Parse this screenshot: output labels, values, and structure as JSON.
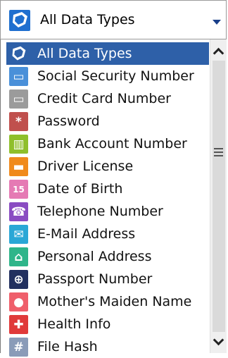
{
  "combo": {
    "selected_label": "All Data Types",
    "icon": "shield-tag-icon"
  },
  "list": {
    "items": [
      {
        "label": "All Data Types",
        "icon": "all-data-types-icon",
        "color": "#3a6fc4",
        "glyph": "",
        "selected": true
      },
      {
        "label": "Social Security Number",
        "icon": "id-card-icon",
        "color": "#4a90d9",
        "glyph": "▭"
      },
      {
        "label": "Credit Card Number",
        "icon": "credit-card-icon",
        "color": "#9b9b9b",
        "glyph": "▭"
      },
      {
        "label": "Password",
        "icon": "asterisk-icon",
        "color": "#c0504d",
        "glyph": "*"
      },
      {
        "label": "Bank Account Number",
        "icon": "bank-icon",
        "color": "#8fbf2b",
        "glyph": "▥"
      },
      {
        "label": "Driver License",
        "icon": "car-icon",
        "color": "#f08a1c",
        "glyph": "▬"
      },
      {
        "label": "Date of Birth",
        "icon": "calendar-icon",
        "color": "#e57ab4",
        "glyph": "15"
      },
      {
        "label": "Telephone Number",
        "icon": "phone-icon",
        "color": "#8a4cc2",
        "glyph": "☎"
      },
      {
        "label": "E-Mail Address",
        "icon": "envelope-icon",
        "color": "#2aa7d6",
        "glyph": "✉"
      },
      {
        "label": "Personal Address",
        "icon": "house-icon",
        "color": "#2eb58a",
        "glyph": "⌂"
      },
      {
        "label": "Passport Number",
        "icon": "globe-icon",
        "color": "#22305f",
        "glyph": "⊕"
      },
      {
        "label": "Mother's Maiden Name",
        "icon": "person-icon",
        "color": "#ef5f6b",
        "glyph": "●"
      },
      {
        "label": "Health Info",
        "icon": "medical-cross-icon",
        "color": "#e03a3a",
        "glyph": "✚"
      },
      {
        "label": "File Hash",
        "icon": "hash-icon",
        "color": "#8a9bb8",
        "glyph": "#"
      }
    ]
  },
  "scrollbar": {
    "up_icon": "chevron-up-icon",
    "down_icon": "chevron-down-icon",
    "grip_icon": "grip-lines-icon"
  }
}
